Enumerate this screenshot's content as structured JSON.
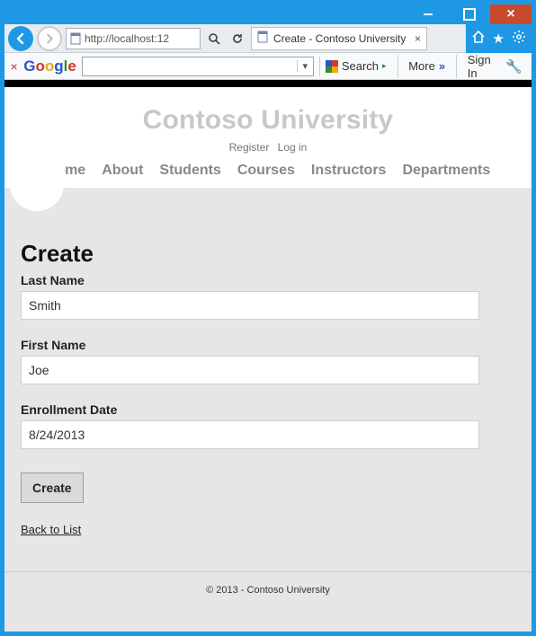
{
  "window": {
    "address": "http://localhost:12",
    "tab_title": "Create - Contoso University"
  },
  "google_toolbar": {
    "logo_letters": [
      "G",
      "o",
      "o",
      "g",
      "l",
      "e"
    ],
    "search_value": "",
    "search_label": "Search",
    "more_label": "More",
    "signin_label": "Sign In"
  },
  "site": {
    "title": "Contoso University",
    "auth": {
      "register": "Register",
      "login": "Log in"
    },
    "menu": [
      "Home",
      "About",
      "Students",
      "Courses",
      "Instructors",
      "Departments"
    ],
    "footer": "© 2013 - Contoso University"
  },
  "form": {
    "heading": "Create",
    "last_name_label": "Last Name",
    "last_name_value": "Smith",
    "first_name_label": "First Name",
    "first_name_value": "Joe",
    "enroll_label": "Enrollment Date",
    "enroll_value": "8/24/2013",
    "submit_label": "Create",
    "back_label": "Back to List"
  }
}
